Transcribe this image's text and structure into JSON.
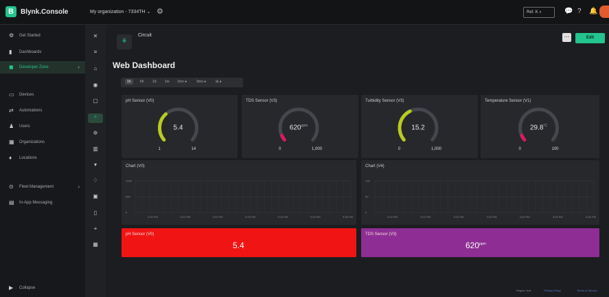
{
  "app": {
    "brand": "Blynk.Console",
    "logo_letter": "B",
    "org_selector": "My organization - 7334TH ⌄",
    "search_text": "Ref. K ⌕",
    "accent": "#23c48e"
  },
  "top_icons": [
    "chat-icon",
    "help-icon",
    "bell-icon"
  ],
  "sidebar": {
    "items": [
      {
        "label": "Get Started",
        "icon": "rocket-icon"
      },
      {
        "label": "Dashboards",
        "icon": "dashboard-icon"
      },
      {
        "label": "Developer Zone",
        "icon": "code-icon",
        "active": true
      },
      {
        "label": "Devices",
        "icon": "devices-icon"
      },
      {
        "label": "Automations",
        "icon": "automation-icon"
      },
      {
        "label": "Users",
        "icon": "users-icon"
      },
      {
        "label": "Organizations",
        "icon": "organization-icon"
      },
      {
        "label": "Locations",
        "icon": "location-icon"
      },
      {
        "label": "Fleet Management",
        "icon": "fleet-icon"
      },
      {
        "label": "In-App Messaging",
        "icon": "message-icon"
      }
    ],
    "collapse_label": "Collapse"
  },
  "device": {
    "name": "Circuit",
    "edit_label": "Edit",
    "more_label": "⋯"
  },
  "page_title": "Web Dashboard",
  "time_ranges": [
    "1h",
    "6h",
    "1d",
    "1w",
    "1mo ●",
    "3mo ●",
    "⊞ ●"
  ],
  "gauges": [
    {
      "title": "pH Sensor (V0)",
      "value": "5.4",
      "unit": "",
      "min": "1",
      "max": "14",
      "fraction": 0.34,
      "color": "#b8cc1f"
    },
    {
      "title": "TDS Sensor (V3)",
      "value": "620",
      "unit": "ppm",
      "min": "0",
      "max": "1,000",
      "fraction": 0.06,
      "color": "#d81b60"
    },
    {
      "title": "Turbidity Sensor (V3)",
      "value": "15.2",
      "unit": "",
      "min": "0",
      "max": "1,000",
      "fraction": 0.4,
      "color": "#b8cc1f"
    },
    {
      "title": "Temperature Sensor (V1)",
      "value": "29.8",
      "unit": "°C",
      "min": "0",
      "max": "100",
      "fraction": 0.06,
      "color": "#d81b60"
    }
  ],
  "charts": [
    {
      "title": "Chart (V0)",
      "y_ticks": [
        "1000",
        "500",
        "0"
      ],
      "x_ticks": [
        "3:20 PM",
        "3:21 PM",
        "3:22 PM",
        "3:23 PM",
        "3:24 PM",
        "3:25 PM",
        "3:26 PM"
      ]
    },
    {
      "title": "Chart (V4)",
      "y_ticks": [
        "100",
        "50",
        "0"
      ],
      "x_ticks": [
        "3:20 PM",
        "3:21 PM",
        "3:22 PM",
        "3:23 PM",
        "3:24 PM",
        "3:25 PM",
        "3:26 PM"
      ]
    }
  ],
  "value_tiles": [
    {
      "title": "pH Sensor (V0)",
      "value": "5.4",
      "unit": "",
      "color": "#f01414"
    },
    {
      "title": "TDS Sensor (V3)",
      "value": "620",
      "unit": "ppm",
      "color": "#8e2d93"
    }
  ],
  "footer": {
    "region": "Region: fra1",
    "privacy": "Privacy Policy",
    "terms": "Terms of Service"
  }
}
